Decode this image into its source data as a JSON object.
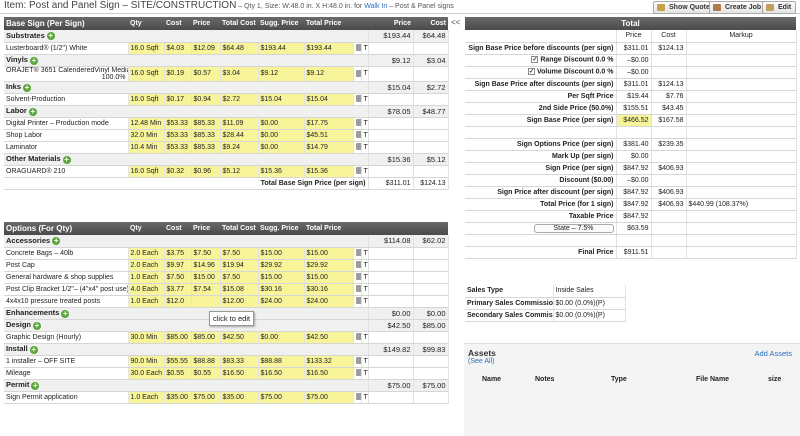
{
  "header": {
    "title": "Item: Post and Panel Sign – SITE/CONSTRUCTION",
    "meta": " – Qty 1, Size: W:48.0 in. X H:48.0 in. for ",
    "link": "Walk In",
    "meta2": " – Post & Panel signs",
    "buttons": [
      "Show Quote",
      "Create Job",
      "Edit"
    ]
  },
  "collapse": "<<",
  "base": {
    "heading": "Base Sign (Per Sign)",
    "columns": [
      "Qty",
      "Cost",
      "Price",
      "Total Cost",
      "Sugg. Price",
      "Total Price",
      "Price",
      "Cost"
    ],
    "sections": [
      {
        "name": "Substrates",
        "price": "$193.44",
        "cost": "$64.48",
        "rows": [
          [
            "Lusterboard® (1/2\") White",
            "16.0 Sqft",
            "$4.03",
            "$12.09",
            "$64.48",
            "$193.44",
            "$193.44"
          ]
        ]
      },
      {
        "name": "Vinyls",
        "price": "$9.12",
        "cost": "$3.04",
        "rows": [
          [
            "ORAJET® 3651 CalenderedVinyl Media(Gray back)",
            "16.0 Sqft",
            "$0.19",
            "$0.57",
            "$3.04",
            "$9.12",
            "$9.12"
          ]
        ],
        "suffix": "100.0%"
      },
      {
        "name": "Inks",
        "price": "$15.04",
        "cost": "$2.72",
        "rows": [
          [
            "Solvent-Production",
            "16.0 Sqft",
            "$0.17",
            "$0.94",
            "$2.72",
            "$15.04",
            "$15.04"
          ]
        ]
      },
      {
        "name": "Labor",
        "price": "$78.05",
        "cost": "$48.77",
        "rows": [
          [
            "Digital Printer – Production mode",
            "12.48 Min",
            "$53.33",
            "$85.33",
            "$11.09",
            "$0.00",
            "$17.75"
          ],
          [
            "Shop Labor",
            "32.0 Min",
            "$53.33",
            "$85.33",
            "$28.44",
            "$0.00",
            "$45.51"
          ],
          [
            "Laminator",
            "10.4 Min",
            "$53.33",
            "$85.33",
            "$9.24",
            "$0.00",
            "$14.79"
          ]
        ]
      },
      {
        "name": "Other Materials",
        "price": "$15.36",
        "cost": "$5.12",
        "rows": [
          [
            "ORAGUARD® 210",
            "16.0 Sqft",
            "$0.32",
            "$0.96",
            "$5.12",
            "$15.36",
            "$15.36"
          ]
        ]
      }
    ],
    "total_label": "Total Base Sign Price (per sign)",
    "total_price": "$311.01",
    "total_cost": "$124.13"
  },
  "options": {
    "heading": "Options (For Qty)",
    "columns": [
      "Qty",
      "Cost",
      "Price",
      "Total Cost",
      "Sugg. Price",
      "Total Price",
      "",
      ""
    ],
    "sections": [
      {
        "name": "Accessories",
        "price": "$114.08",
        "cost": "$62.02",
        "rows": [
          [
            "Concrete Bags – 40lb",
            "2.0 Each",
            "$3.75",
            "$7.50",
            "$7.50",
            "$15.00",
            "$15.00"
          ],
          [
            "Post Cap",
            "2.0 Each",
            "$9.97",
            "$14.96",
            "$19.94",
            "$29.92",
            "$29.92"
          ],
          [
            "General hardware & shop supplies",
            "1.0 Each",
            "$7.50",
            "$15.00",
            "$7.50",
            "$15.00",
            "$15.00"
          ],
          [
            "Post Clip Bracket 1/2\"– (4\"x4\" post use)",
            "4.0 Each",
            "$3.77",
            "$7.54",
            "$15.08",
            "$30.16",
            "$30.16"
          ],
          [
            "4x4x10 pressure treated posts",
            "1.0 Each",
            "$12.0",
            "",
            "$12.00",
            "$24.00",
            "$24.00"
          ]
        ]
      },
      {
        "name": "Enhancements",
        "price": "$0.00",
        "cost": "$0.00",
        "rows": []
      },
      {
        "name": "Design",
        "price": "$42.50",
        "cost": "$85.00",
        "rows": [
          [
            "Graphic Design (Hourly)",
            "30.0 Min",
            "$85.00",
            "$85.00",
            "$42.50",
            "$0.00",
            "$42.50"
          ]
        ]
      },
      {
        "name": "Install",
        "price": "$149.82",
        "cost": "$99.83",
        "rows": [
          [
            "1 installer – OFF SITE",
            "90.0 Min",
            "$55.55",
            "$88.88",
            "$83.33",
            "$88.88",
            "$133.32"
          ],
          [
            "Mileage",
            "30.0 Each",
            "$0.55",
            "$0.55",
            "$16.50",
            "$16.50",
            "$16.50"
          ]
        ]
      },
      {
        "name": "Permit",
        "price": "$75.00",
        "cost": "$75.00",
        "rows": [
          [
            "Sign Permit application",
            "1.0 Each",
            "$35.00",
            "$75.00",
            "$35.00",
            "$75.00",
            "$75.00"
          ]
        ]
      }
    ]
  },
  "total": {
    "heading": "Total",
    "columns": [
      "Price",
      "Cost",
      "Markup"
    ],
    "rows": [
      {
        "label": "Sign Base Price before discounts (per sign)",
        "price": "$311.01",
        "cost": "$124.13",
        "markup": ""
      },
      {
        "label": "Range Discount  0.0 %",
        "price": "–$0.00",
        "cost": "",
        "markup": "",
        "check": true
      },
      {
        "label": "Volume Discount  0.0 %",
        "price": "–$0.00",
        "cost": "",
        "markup": "",
        "check": true
      },
      {
        "label": "Sign Base Price after discounts (per sign)",
        "price": "$311.01",
        "cost": "$124.13",
        "markup": ""
      },
      {
        "label": "Per Sqft Price",
        "price": "$19.44",
        "cost": "$7.76",
        "markup": ""
      },
      {
        "label": "2nd Side Price (50.0%)",
        "price": "$155.51",
        "cost": "$43.45",
        "markup": ""
      },
      {
        "label": "Sign Base Price (per sign)",
        "price": "$466.52",
        "cost": "$167.58",
        "markup": "",
        "hl": true
      },
      {
        "label": "",
        "price": "",
        "cost": "",
        "markup": ""
      },
      {
        "label": "Sign Options Price (per sign)",
        "price": "$381.40",
        "cost": "$239.35",
        "markup": ""
      },
      {
        "label": "Mark Up (per sign)",
        "price": "$0.00",
        "cost": "",
        "markup": ""
      },
      {
        "label": "Sign Price (per sign)",
        "price": "$847.92",
        "cost": "$406.93",
        "markup": ""
      },
      {
        "label": "Discount ($0.00)",
        "price": "–$0.00",
        "cost": "",
        "markup": ""
      },
      {
        "label": "Sign Price after discount (per sign)",
        "price": "$847.92",
        "cost": "$406.93",
        "markup": ""
      },
      {
        "label": "Total Price (for 1 sign)",
        "price": "$847.92",
        "cost": "$406.93",
        "markup": "$440.99 (108.37%)"
      },
      {
        "label": "Taxable Price",
        "price": "$847.92",
        "cost": "",
        "markup": ""
      },
      {
        "label": "State – 7.5%",
        "price": "$63.59",
        "cost": "",
        "markup": "",
        "select": true
      },
      {
        "label": "",
        "price": "",
        "cost": "",
        "markup": ""
      },
      {
        "label": "Final Price",
        "price": "$911.51",
        "cost": "",
        "markup": ""
      }
    ]
  },
  "sales": {
    "rows": [
      [
        "Sales Type",
        "Inside Sales"
      ],
      [
        "Primary Sales Commission",
        "$0.00 (0.0%)(P)"
      ],
      [
        "Secondary Sales Commission",
        "$0.00 (0.0%)(P)"
      ]
    ]
  },
  "assets": {
    "heading": "Assets",
    "see_all": "(See All)",
    "add": "Add Assets",
    "columns": [
      "Name",
      "Notes",
      "Type",
      "File Name",
      "size"
    ]
  },
  "tooltip": "click to edit"
}
